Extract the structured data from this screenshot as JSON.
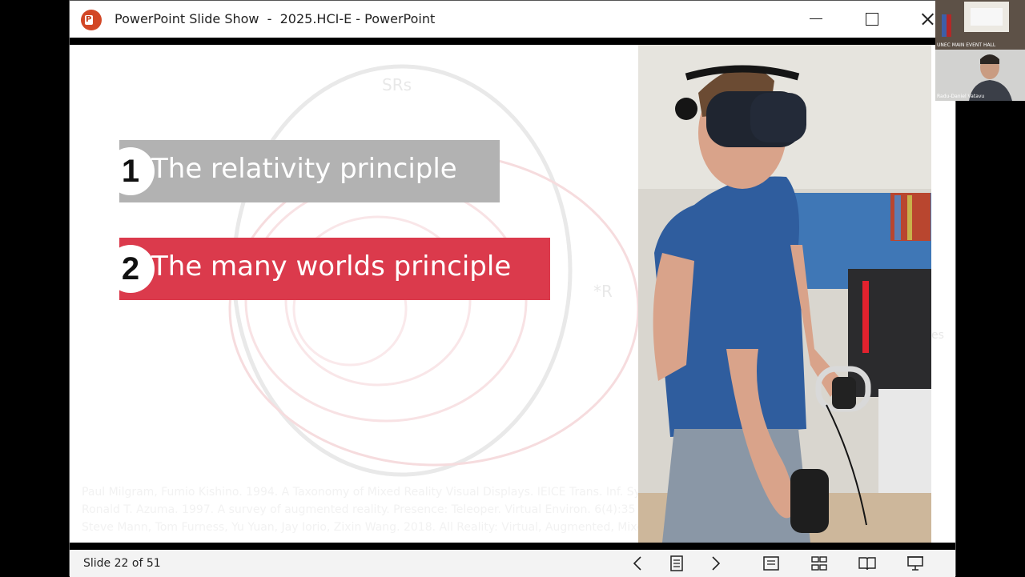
{
  "window": {
    "title": "PowerPoint Slide Show  -  2025.HCI-E - PowerPoint"
  },
  "slide": {
    "background_labels": {
      "srs": "SRs",
      "r": "*R",
      "es": "es"
    },
    "principles": [
      {
        "number": "1",
        "text": "The relativity principle",
        "color": "#b2b2b2"
      },
      {
        "number": "2",
        "text": "The many worlds principle",
        "color": "#db3a4c"
      }
    ],
    "references": [
      "Paul Milgram, Fumio Kishino. 1994. A Taxonomy of Mixed Reality Visual Displays. IEICE Trans. Inf. Sy",
      "Ronald T. Azuma. 1997. A survey of augmented reality. Presence: Teleoper. Virtual Environ. 6(4):35",
      "Steve Mann, Tom Furness, Yu Yuan, Jay Iorio, Zixin Wang. 2018. All Reality: Virtual, Augmented, Mixe"
    ]
  },
  "statusbar": {
    "slide_counter": "Slide 22 of 51",
    "icons": [
      "previous-icon",
      "slide-list-icon",
      "next-icon",
      "normal-view-icon",
      "slide-sorter-icon",
      "reading-view-icon",
      "slide-show-icon"
    ]
  },
  "webcams": {
    "room_label": "UNEC MAIN EVENT HALL",
    "participant_name": "Radu-Daniel Vatavu"
  },
  "colors": {
    "accent_red": "#db3a4c",
    "accent_gray": "#b2b2b2",
    "powerpoint_orange": "#d24726"
  }
}
